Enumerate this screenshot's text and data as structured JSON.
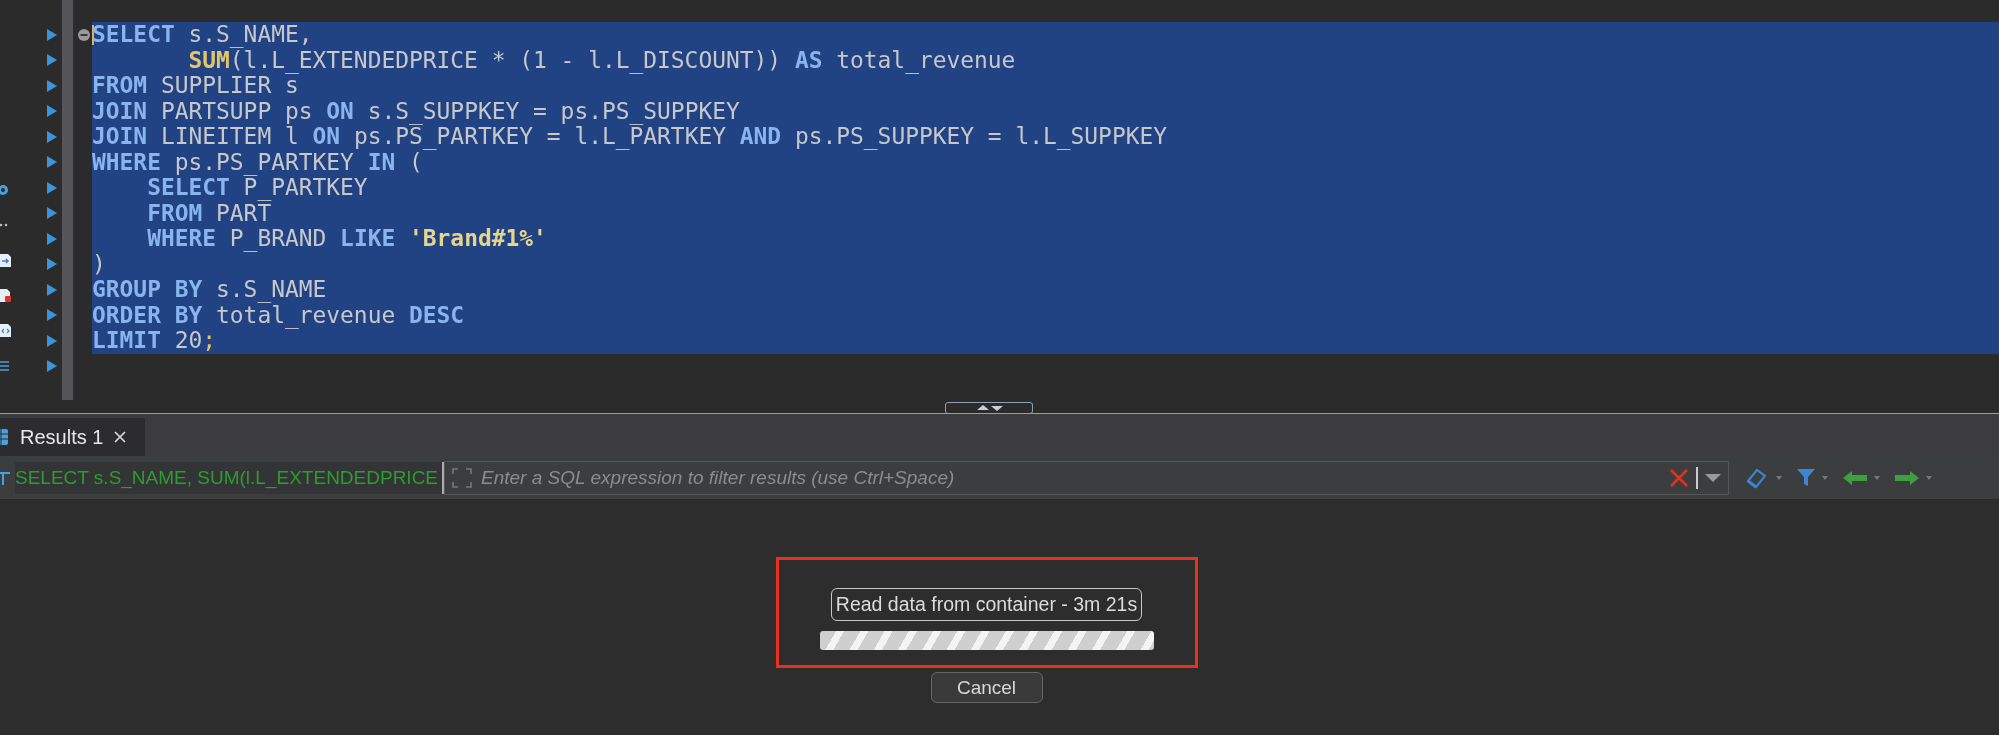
{
  "editor": {
    "lines": [
      {
        "selected": true,
        "cursor": true,
        "fold_marker": true,
        "tokens": [
          {
            "text": "SELECT",
            "kind": "keyword"
          },
          {
            "text": " s.S_NAME,",
            "kind": "plain"
          }
        ]
      },
      {
        "selected": true,
        "cursor": false,
        "fold_marker": false,
        "tokens": [
          {
            "text": "       SUM",
            "kind": "function"
          },
          {
            "text": "(l.L_EXTENDEDPRICE * (1 - l.L_DISCOUNT)) ",
            "kind": "plain"
          },
          {
            "text": "AS",
            "kind": "keyword"
          },
          {
            "text": " total_revenue",
            "kind": "plain"
          }
        ]
      },
      {
        "selected": true,
        "cursor": false,
        "fold_marker": false,
        "tokens": [
          {
            "text": "FROM",
            "kind": "keyword"
          },
          {
            "text": " SUPPLIER s",
            "kind": "plain"
          }
        ]
      },
      {
        "selected": true,
        "cursor": false,
        "fold_marker": false,
        "tokens": [
          {
            "text": "JOIN",
            "kind": "keyword"
          },
          {
            "text": " PARTSUPP ps ",
            "kind": "plain"
          },
          {
            "text": "ON",
            "kind": "keyword"
          },
          {
            "text": " s.S_SUPPKEY = ps.PS_SUPPKEY",
            "kind": "plain"
          }
        ]
      },
      {
        "selected": true,
        "cursor": false,
        "fold_marker": false,
        "tokens": [
          {
            "text": "JOIN",
            "kind": "keyword"
          },
          {
            "text": " LINEITEM l ",
            "kind": "plain"
          },
          {
            "text": "ON",
            "kind": "keyword"
          },
          {
            "text": " ps.PS_PARTKEY = l.L_PARTKEY ",
            "kind": "plain"
          },
          {
            "text": "AND",
            "kind": "keyword"
          },
          {
            "text": " ps.PS_SUPPKEY = l.L_SUPPKEY",
            "kind": "plain"
          }
        ]
      },
      {
        "selected": true,
        "cursor": false,
        "fold_marker": false,
        "tokens": [
          {
            "text": "WHERE",
            "kind": "keyword"
          },
          {
            "text": " ps.PS_PARTKEY ",
            "kind": "plain"
          },
          {
            "text": "IN",
            "kind": "keyword"
          },
          {
            "text": " (",
            "kind": "plain"
          }
        ]
      },
      {
        "selected": true,
        "cursor": false,
        "fold_marker": false,
        "tokens": [
          {
            "text": "    SELECT",
            "kind": "keyword"
          },
          {
            "text": " P_PARTKEY",
            "kind": "plain"
          }
        ]
      },
      {
        "selected": true,
        "cursor": false,
        "fold_marker": false,
        "tokens": [
          {
            "text": "    FROM",
            "kind": "keyword"
          },
          {
            "text": " PART",
            "kind": "plain"
          }
        ]
      },
      {
        "selected": true,
        "cursor": false,
        "fold_marker": false,
        "tokens": [
          {
            "text": "    WHERE",
            "kind": "keyword"
          },
          {
            "text": " P_BRAND ",
            "kind": "plain"
          },
          {
            "text": "LIKE",
            "kind": "keyword"
          },
          {
            "text": " 'Brand#1%'",
            "kind": "string"
          }
        ]
      },
      {
        "selected": true,
        "cursor": false,
        "fold_marker": false,
        "tokens": [
          {
            "text": ")",
            "kind": "plain"
          }
        ]
      },
      {
        "selected": true,
        "cursor": false,
        "fold_marker": false,
        "tokens": [
          {
            "text": "GROUP BY",
            "kind": "keyword"
          },
          {
            "text": " s.S_NAME",
            "kind": "plain"
          }
        ]
      },
      {
        "selected": true,
        "cursor": false,
        "fold_marker": false,
        "tokens": [
          {
            "text": "ORDER BY",
            "kind": "keyword"
          },
          {
            "text": " total_revenue ",
            "kind": "plain"
          },
          {
            "text": "DESC",
            "kind": "keyword"
          }
        ]
      },
      {
        "selected": true,
        "cursor": false,
        "fold_marker": false,
        "tokens": [
          {
            "text": "LIMIT",
            "kind": "keyword"
          },
          {
            "text": " 20",
            "kind": "plain"
          },
          {
            "text": ";",
            "kind": "punct"
          }
        ]
      }
    ]
  },
  "results_tab": {
    "label": "Results 1",
    "selected": true
  },
  "filter_bar": {
    "query": "SELECT s.S_NAME, SUM(l.L_EXTENDEDPRICE",
    "placeholder": "Enter a SQL expression to filter results (use Ctrl+Space)"
  },
  "progress": {
    "label": "Read data from container - 3m 21s",
    "indeterminate": true
  },
  "buttons": [
    {
      "label": "Cancel"
    }
  ]
}
